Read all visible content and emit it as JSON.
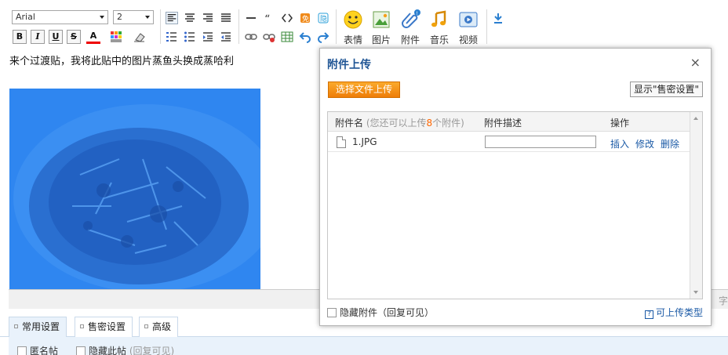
{
  "toolbar": {
    "font_family": "Arial",
    "font_size": "2",
    "bold": "B",
    "italic": "I",
    "underline": "U",
    "strike": "S",
    "font_color": "A",
    "emoticon_label": "表情",
    "image_label": "图片",
    "attachment_label": "附件",
    "music_label": "音乐",
    "video_label": "视频"
  },
  "editor": {
    "text": "来个过渡贴，我将此贴中的图片蒸鱼头换成蒸哈利",
    "status_char": "字"
  },
  "tabs": [
    {
      "label": "常用设置"
    },
    {
      "label": "售密设置"
    },
    {
      "label": "高级"
    }
  ],
  "settings": {
    "anonymous": "匿名帖",
    "hide_post": "隐藏此帖",
    "hide_post_hint": "(回复可见)"
  },
  "dialog": {
    "title": "附件上传",
    "close": "×",
    "upload_button": "选择文件上传",
    "show_settings_button": "显示\"售密设置\"",
    "col_name": "附件名",
    "col_name_hint_pre": "(您还可以上传",
    "col_name_hint_num": "8",
    "col_name_hint_post": "个附件)",
    "col_desc": "附件描述",
    "col_ops": "操作",
    "files": [
      {
        "name": "1.JPG",
        "desc": "",
        "insert": "插入",
        "edit": "修改",
        "delete": "删除"
      }
    ],
    "hide_attachment": "隐藏附件（回复可见）",
    "allowed_types": "可上传类型"
  },
  "colors": {
    "accent_blue": "#1e5494",
    "link_blue": "#1b5aa6",
    "upload_orange": "#ee7d08",
    "photo_tint": "#2f86f0"
  }
}
